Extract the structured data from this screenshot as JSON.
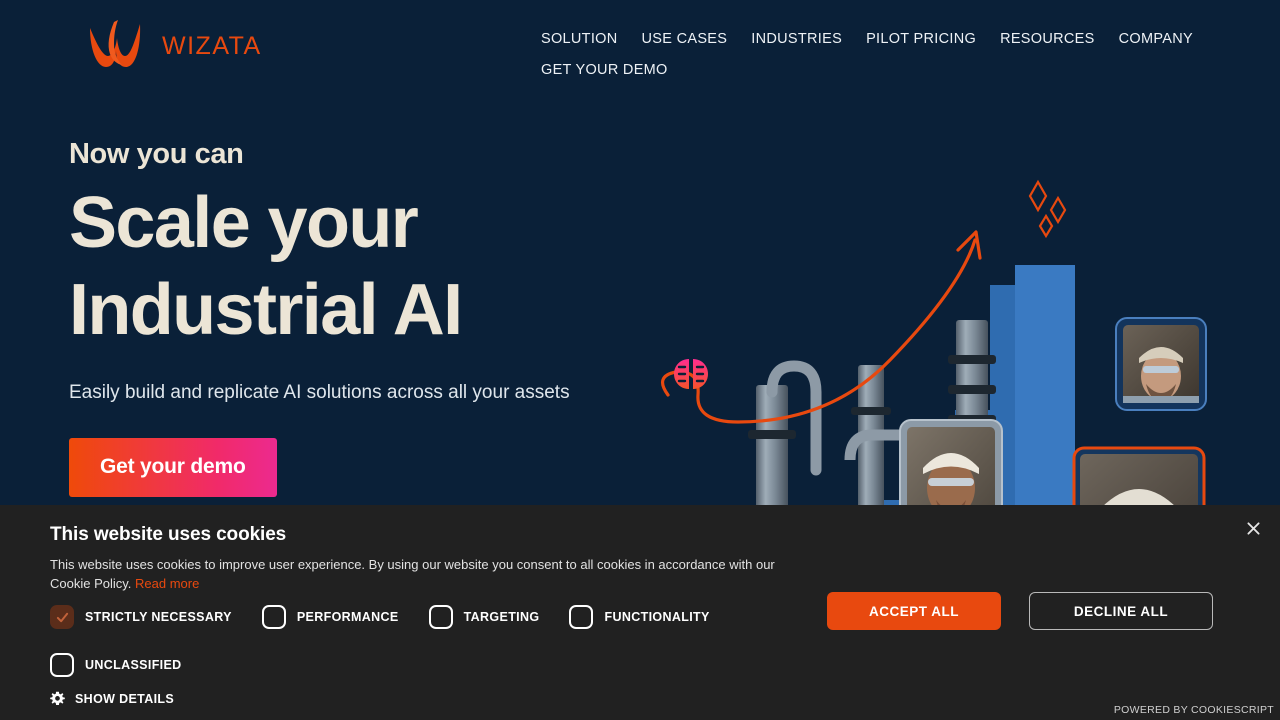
{
  "brand": {
    "name": "WIZATA",
    "logo_icon": "wizata-flame-w-logo",
    "logo_color": "#e8490f"
  },
  "nav": {
    "items": [
      {
        "label": "SOLUTION",
        "name": "nav-solution"
      },
      {
        "label": "USE CASES",
        "name": "nav-use-cases"
      },
      {
        "label": "INDUSTRIES",
        "name": "nav-industries"
      },
      {
        "label": "PILOT PRICING",
        "name": "nav-pilot-pricing"
      },
      {
        "label": "RESOURCES",
        "name": "nav-resources"
      },
      {
        "label": "COMPANY",
        "name": "nav-company"
      },
      {
        "label": "GET YOUR DEMO",
        "name": "nav-get-your-demo"
      }
    ]
  },
  "hero": {
    "eyebrow": "Now you can",
    "headline_line1": "Scale your",
    "headline_line2": "Industrial AI",
    "subhead": "Easily build and replicate AI  solutions across all your assets",
    "cta_label": "Get your demo",
    "cta_gradient_from": "#ef4a0a",
    "cta_gradient_to": "#ec2a8f",
    "background_color": "#0a2038",
    "heading_color": "#ece5d6",
    "illustration": {
      "name": "industrial-ai-hero-illustration",
      "elements": [
        "brain-icon",
        "growth-curve-arrow",
        "bar-chart-columns",
        "industrial-pipes",
        "worker-photo-card-female",
        "worker-photo-card-bearded-male",
        "worker-photo-card-male",
        "sparkle-diamonds"
      ],
      "bar_color": "#2f6cb0",
      "accent_color": "#e8490f",
      "brain_gradient_from": "#ff2d8f",
      "brain_gradient_to": "#f6532a"
    }
  },
  "cookie_banner": {
    "title": "This website uses cookies",
    "description": "This website uses cookies to improve user experience. By using our website you consent to all cookies in accordance with our Cookie Policy.",
    "read_more_label": "Read more",
    "background_color": "#212121",
    "accent_color": "#e8490f",
    "close_icon": "close-icon",
    "categories": [
      {
        "label": "STRICTLY NECESSARY",
        "checked": true,
        "name": "checkbox-strictly-necessary"
      },
      {
        "label": "PERFORMANCE",
        "checked": false,
        "name": "checkbox-performance"
      },
      {
        "label": "TARGETING",
        "checked": false,
        "name": "checkbox-targeting"
      },
      {
        "label": "FUNCTIONALITY",
        "checked": false,
        "name": "checkbox-functionality"
      }
    ],
    "unclassified": {
      "label": "UNCLASSIFIED",
      "checked": false,
      "name": "checkbox-unclassified"
    },
    "show_details_label": "SHOW DETAILS",
    "show_details_icon": "gear-icon",
    "accept_label": "ACCEPT ALL",
    "decline_label": "DECLINE ALL",
    "powered_by": "POWERED BY COOKIESCRIPT"
  }
}
